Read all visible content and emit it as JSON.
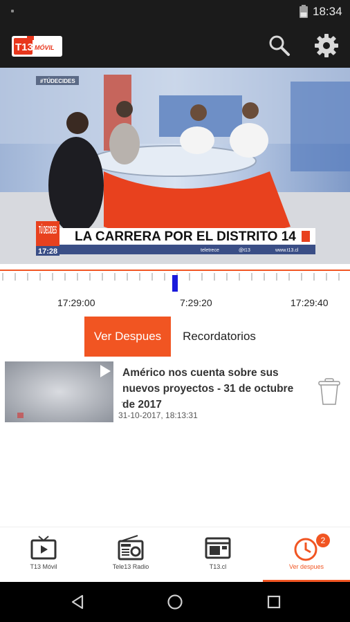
{
  "status_bar": {
    "time": "18:34"
  },
  "app_bar": {
    "logo_text": "T13",
    "logo_sub": "MÓVIL",
    "search_icon": "search-icon",
    "settings_icon": "gear-icon"
  },
  "video": {
    "hashtag": "#TÚDECIDES",
    "program_logo": "TÚ DECIDES",
    "clock": "17:28",
    "headline": "LA CARRERA POR EL DISTRITO 14",
    "facebook": "teletrece",
    "twitter": "@t13",
    "website": "www.t13.cl"
  },
  "timeline": {
    "ticks": [
      "17:29:00",
      "7:29:20",
      "17:29:40"
    ]
  },
  "tabs": {
    "active": "Ver Despues",
    "inactive": "Recordatorios"
  },
  "saved_items": [
    {
      "title": "Américo nos cuenta sobre sus nuevos proyectos - 31 de octubre de 2017",
      "subtitle": "-",
      "date": "31-10-2017, 18:13:31"
    }
  ],
  "bottom_nav": [
    {
      "label": "T13 Móvil",
      "icon": "tv-icon"
    },
    {
      "label": "Tele13 Radio",
      "icon": "radio-icon"
    },
    {
      "label": "T13.cl",
      "icon": "browser-icon"
    },
    {
      "label": "Ver despues",
      "icon": "clock-icon",
      "badge": "2"
    }
  ],
  "colors": {
    "accent": "#f15522",
    "bar": "#1b1b1b",
    "playhead": "#1a1adc"
  }
}
